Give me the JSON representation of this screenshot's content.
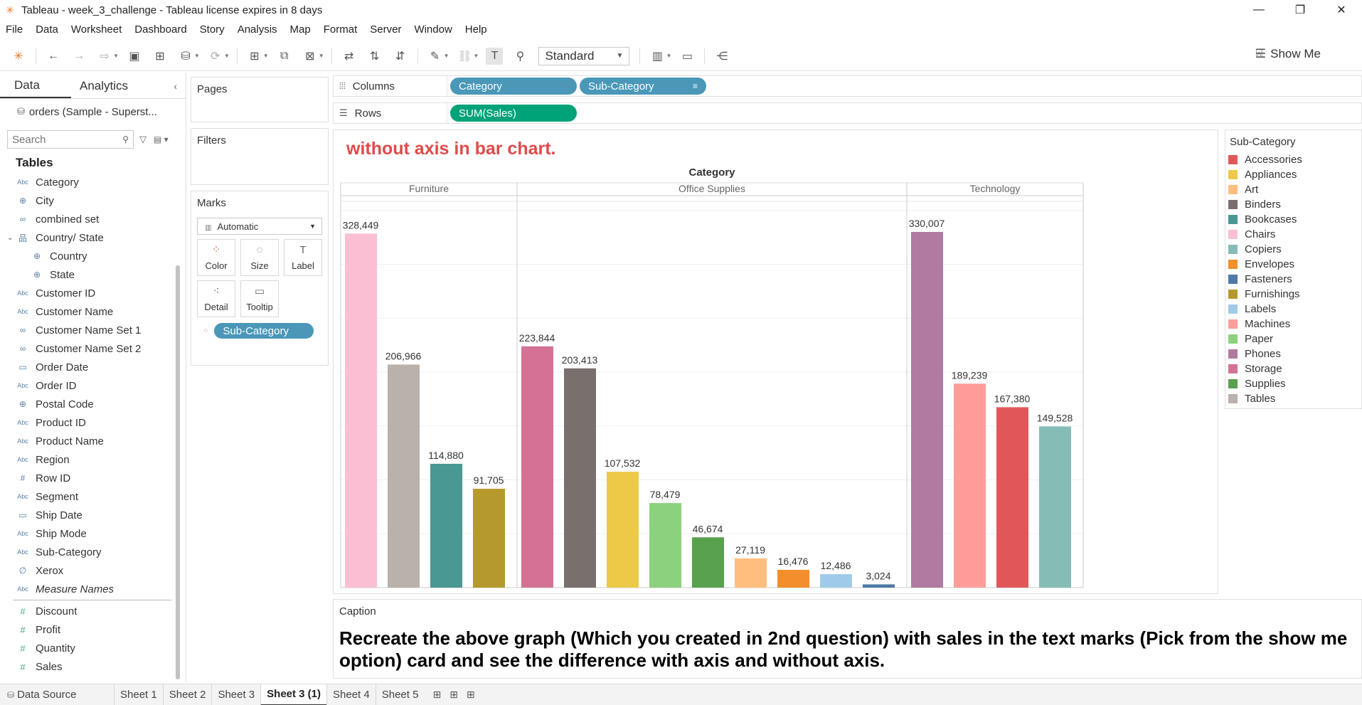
{
  "window": {
    "title": "Tableau - week_3_challenge - Tableau license expires in 8 days",
    "minimize": "—",
    "restore": "❐",
    "close": "✕"
  },
  "menu": [
    "File",
    "Data",
    "Worksheet",
    "Dashboard",
    "Story",
    "Analysis",
    "Map",
    "Format",
    "Server",
    "Window",
    "Help"
  ],
  "toolbar": {
    "fit_select": "Standard",
    "show_me_label": "Show Me"
  },
  "data_pane": {
    "tab_data": "Data",
    "tab_analytics": "Analytics",
    "datasource": "orders (Sample - Superst...",
    "search_placeholder": "Search",
    "tables_heading": "Tables",
    "fields": [
      {
        "label": "Category",
        "icon": "Abc"
      },
      {
        "label": "City",
        "icon": "⊕"
      },
      {
        "label": "combined set",
        "icon": "∞"
      },
      {
        "label": "Country/ State",
        "icon": "品"
      },
      {
        "label": "Country",
        "icon": "⊕"
      },
      {
        "label": "State",
        "icon": "⊕"
      },
      {
        "label": "Customer ID",
        "icon": "Abc"
      },
      {
        "label": "Customer Name",
        "icon": "Abc"
      },
      {
        "label": "Customer Name Set 1",
        "icon": "∞"
      },
      {
        "label": "Customer Name Set 2",
        "icon": "∞"
      },
      {
        "label": "Order Date",
        "icon": "▭"
      },
      {
        "label": "Order ID",
        "icon": "Abc"
      },
      {
        "label": "Postal Code",
        "icon": "⊕"
      },
      {
        "label": "Product ID",
        "icon": "Abc"
      },
      {
        "label": "Product Name",
        "icon": "Abc"
      },
      {
        "label": "Region",
        "icon": "Abc"
      },
      {
        "label": "Row ID",
        "icon": "#"
      },
      {
        "label": "Segment",
        "icon": "Abc"
      },
      {
        "label": "Ship Date",
        "icon": "▭"
      },
      {
        "label": "Ship Mode",
        "icon": "Abc"
      },
      {
        "label": "Sub-Category",
        "icon": "Abc"
      },
      {
        "label": "Xerox",
        "icon": "∅"
      },
      {
        "label": "Measure Names",
        "icon": "Abc"
      }
    ],
    "measures": [
      {
        "label": "Discount",
        "icon": "#"
      },
      {
        "label": "Profit",
        "icon": "#"
      },
      {
        "label": "Quantity",
        "icon": "#"
      },
      {
        "label": "Sales",
        "icon": "#"
      }
    ]
  },
  "cards": {
    "pages": "Pages",
    "filters": "Filters",
    "marks": "Marks",
    "mark_type": "Automatic",
    "buttons": {
      "color": "Color",
      "size": "Size",
      "label": "Label",
      "detail": "Detail",
      "tooltip": "Tooltip"
    },
    "color_pill": "Sub-Category"
  },
  "shelves": {
    "columns_label": "Columns",
    "rows_label": "Rows",
    "columns_pills": [
      "Category",
      "Sub-Category"
    ],
    "rows_pill": "SUM(Sales)"
  },
  "view": {
    "title": "without axis in bar chart."
  },
  "legend": {
    "title": "Sub-Category",
    "items": [
      {
        "label": "Accessories",
        "color": "#e15759"
      },
      {
        "label": "Appliances",
        "color": "#edc948"
      },
      {
        "label": "Art",
        "color": "#ffbe7d"
      },
      {
        "label": "Binders",
        "color": "#79706e"
      },
      {
        "label": "Bookcases",
        "color": "#499894"
      },
      {
        "label": "Chairs",
        "color": "#fabfd2"
      },
      {
        "label": "Copiers",
        "color": "#86bcb6"
      },
      {
        "label": "Envelopes",
        "color": "#f28e2b"
      },
      {
        "label": "Fasteners",
        "color": "#4e79a7"
      },
      {
        "label": "Furnishings",
        "color": "#b6992d"
      },
      {
        "label": "Labels",
        "color": "#a0cbe8"
      },
      {
        "label": "Machines",
        "color": "#ff9d9a"
      },
      {
        "label": "Paper",
        "color": "#8cd17d"
      },
      {
        "label": "Phones",
        "color": "#b07aa1"
      },
      {
        "label": "Storage",
        "color": "#d37295"
      },
      {
        "label": "Supplies",
        "color": "#59a14f"
      },
      {
        "label": "Tables",
        "color": "#bab0ac"
      }
    ]
  },
  "chart_data": {
    "type": "bar",
    "header_title": "Category",
    "groups": [
      {
        "name": "Furniture",
        "bars": [
          {
            "sub": "Chairs",
            "value": 328449,
            "label": "328,449",
            "color": "#fabfd2"
          },
          {
            "sub": "Tables",
            "value": 206966,
            "label": "206,966",
            "color": "#bab0ac"
          },
          {
            "sub": "Bookcases",
            "value": 114880,
            "label": "114,880",
            "color": "#499894"
          },
          {
            "sub": "Furnishings",
            "value": 91705,
            "label": "91,705",
            "color": "#b6992d"
          }
        ]
      },
      {
        "name": "Office Supplies",
        "bars": [
          {
            "sub": "Storage",
            "value": 223844,
            "label": "223,844",
            "color": "#d37295"
          },
          {
            "sub": "Binders",
            "value": 203413,
            "label": "203,413",
            "color": "#79706e"
          },
          {
            "sub": "Appliances",
            "value": 107532,
            "label": "107,532",
            "color": "#edc948"
          },
          {
            "sub": "Paper",
            "value": 78479,
            "label": "78,479",
            "color": "#8cd17d"
          },
          {
            "sub": "Supplies",
            "value": 46674,
            "label": "46,674",
            "color": "#59a14f"
          },
          {
            "sub": "Art",
            "value": 27119,
            "label": "27,119",
            "color": "#ffbe7d"
          },
          {
            "sub": "Envelopes",
            "value": 16476,
            "label": "16,476",
            "color": "#f28e2b"
          },
          {
            "sub": "Labels",
            "value": 12486,
            "label": "12,486",
            "color": "#a0cbe8"
          },
          {
            "sub": "Fasteners",
            "value": 3024,
            "label": "3,024",
            "color": "#4e79a7"
          }
        ]
      },
      {
        "name": "Technology",
        "bars": [
          {
            "sub": "Phones",
            "value": 330007,
            "label": "330,007",
            "color": "#b07aa1"
          },
          {
            "sub": "Machines",
            "value": 189239,
            "label": "189,239",
            "color": "#ff9d9a"
          },
          {
            "sub": "Accessories",
            "value": 167380,
            "label": "167,380",
            "color": "#e15759"
          },
          {
            "sub": "Copiers",
            "value": 149528,
            "label": "149,528",
            "color": "#86bcb6"
          }
        ]
      }
    ],
    "ylim": [
      0,
      350000
    ],
    "grid": true,
    "axis_visible": false
  },
  "caption": {
    "title": "Caption",
    "text": "Recreate the above graph (Which you created in 2nd question) with sales in the text marks (Pick from the show me option) card and see the difference with axis and without axis."
  },
  "bottom": {
    "datasource_tab": "Data Source",
    "sheets": [
      "Sheet 1",
      "Sheet 2",
      "Sheet 3",
      "Sheet 3 (1)",
      "Sheet 4",
      "Sheet 5"
    ],
    "active_sheet": "Sheet 3 (1)"
  }
}
